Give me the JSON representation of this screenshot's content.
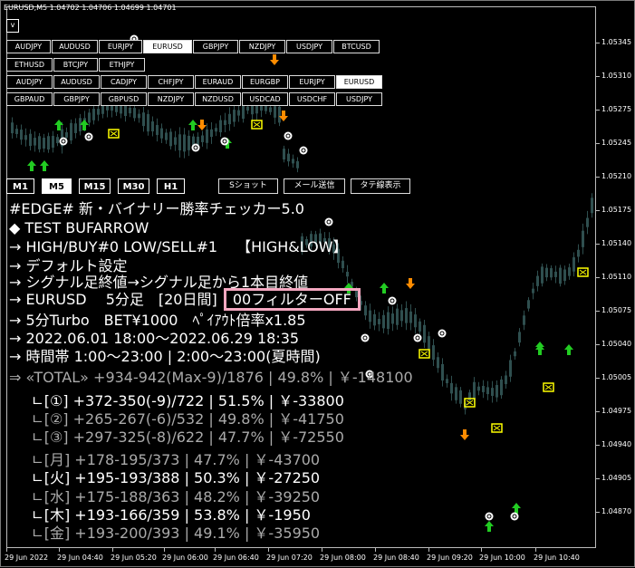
{
  "chart_header": "EURUSD,M5  1.04702 1.04706 1.04699 1.04701",
  "v_label": "v",
  "symbol_rows": [
    [
      "AUDJPY",
      "AUDUSD",
      "EURJPY",
      "EURUSD",
      "GBPJPY",
      "NZDJPY",
      "USDJPY",
      "BTCUSD"
    ],
    [
      "ETHUSD",
      "BTCJPY",
      "ETHJPY"
    ],
    [
      "AUDJPY",
      "AUDUSD",
      "CADJPY",
      "CHFJPY",
      "EURAUD",
      "EURGBP",
      "EURJPY",
      "EURUSD"
    ],
    [
      "GBPAUD",
      "GBPJPY",
      "GBPUSD",
      "NZDJPY",
      "NZDUSD",
      "USDCAD",
      "USDCHF",
      "USDJPY"
    ]
  ],
  "active_symbols": {
    "row0": "EURUSD",
    "row2": "EURUSD"
  },
  "timeframes": [
    "M1",
    "M5",
    "M15",
    "M30",
    "H1"
  ],
  "active_timeframe": "M5",
  "action_buttons": [
    "Sショット",
    "メール送信",
    "タテ線表示"
  ],
  "info": {
    "title": "#EDGE# 新・バイナリー勝率チェッカー5.0",
    "test": "◆ TEST BUFARROW",
    "highlow": "→ HIGH/BUY#0  LOW/SELL#1　 【HIGH&LOW】",
    "default": "→ デフォルト設定",
    "signal": "→ シグナル足終値→シグナル足から1本目終値",
    "pair_prefix": "→ EURUSD　 5分足　[20日間]",
    "filter": "00フィルターOFF",
    "turbo": "→ 5分Turbo　BET¥1000　ﾍﾟｲｱｳﾄ倍率x1.85",
    "period": "→ 2022.06.01 18:00～2022.06.29 18:35",
    "hours": "→ 時間帯 1:00～23:00 | 2:00～23:00(夏時間)",
    "total": "⇒ «TOTAL» +934-942(Max-9)/1876 | 49.8% | ￥-148100"
  },
  "stats": [
    {
      "text": "ㄴ[①] +372-350(-9)/722 | 51.5% | ￥-33800",
      "bright": true
    },
    {
      "text": "ㄴ[②] +265-267(-6)/532 | 49.8% | ￥-41750",
      "bright": false
    },
    {
      "text": "ㄴ[③] +297-325(-8)/622 | 47.7% | ￥-72550",
      "bright": false
    }
  ],
  "weekdays": [
    {
      "text": "ㄴ[月] +178-195/373 | 47.7% | ￥-43700",
      "bright": false
    },
    {
      "text": "ㄴ[火] +195-193/388 | 50.3% | ￥-27250",
      "bright": true
    },
    {
      "text": "ㄴ[水] +175-188/363 | 48.2% | ￥-39250",
      "bright": false
    },
    {
      "text": "ㄴ[木] +193-166/359 | 53.8% | ￥-1950",
      "bright": true
    },
    {
      "text": "ㄴ[金] +193-200/393 | 49.1% | ￥-35950",
      "bright": false
    }
  ],
  "price_axis": [
    "1.05345",
    "1.05310",
    "1.05275",
    "1.05245",
    "1.05210",
    "1.05175",
    "1.05140",
    "1.05110",
    "1.05075",
    "1.05040",
    "1.05005",
    "1.04975",
    "1.04940",
    "1.04905",
    "1.04870",
    "1.04835"
  ],
  "time_axis": [
    "29 Jun 2022",
    "29 Jun 04:40",
    "29 Jun 05:20",
    "29 Jun 06:00",
    "29 Jun 06:40",
    "29 Jun 07:20",
    "29 Jun 08:00",
    "29 Jun 08:40",
    "29 Jun 09:20",
    "29 Jun 10:00",
    "29 Jun 10:40"
  ],
  "colors": {
    "candle": "#2f4f4f",
    "up_arrow": "#22cc22",
    "down_arrow": "#ff8c00",
    "box": "#ffff00",
    "filter_border": "#f4a7c0"
  }
}
